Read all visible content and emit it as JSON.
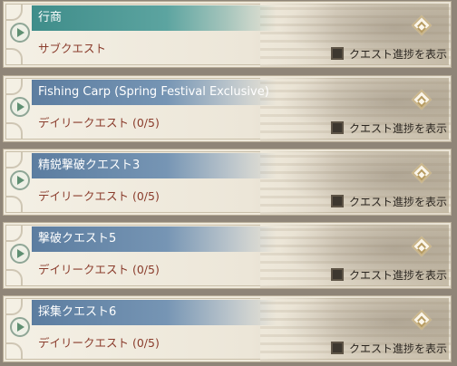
{
  "ui": {
    "toggle_label": "クエスト進捗を表示",
    "colors": {
      "title_bg_blue": "#5c7da0",
      "title_bg_green": "#3f8d8a",
      "subtitle_text": "#8a3c2c",
      "card_bg": "#f4f0e5"
    },
    "icons": {
      "expand": "play-triangle-icon",
      "diamond": "diamond-chevron-icon",
      "checkbox": "checkbox-icon"
    }
  },
  "quests": [
    {
      "title": "行商",
      "subtitle": "サブクエスト",
      "style": "green"
    },
    {
      "title": "Fishing Carp (Spring Festival Exclusive)",
      "subtitle": "デイリークエスト (0/5)",
      "style": "blue"
    },
    {
      "title": "精鋭撃破クエスト3",
      "subtitle": "デイリークエスト (0/5)",
      "style": "blue"
    },
    {
      "title": "撃破クエスト5",
      "subtitle": "デイリークエスト (0/5)",
      "style": "blue"
    },
    {
      "title": "採集クエスト6",
      "subtitle": "デイリークエスト (0/5)",
      "style": "blue"
    }
  ]
}
